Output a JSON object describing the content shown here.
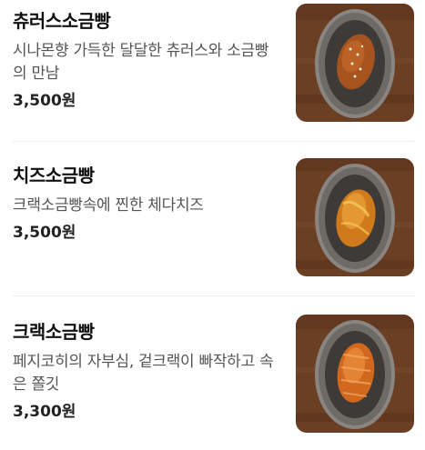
{
  "menu": {
    "items": [
      {
        "name": "츄러스소금빵",
        "description": "시나몬향 가득한 달달한 츄러스와 소금빵의 만남",
        "price": "3,500원"
      },
      {
        "name": "치즈소금빵",
        "description": "크랙소금빵속에 찐한 체다치즈",
        "price": "3,500원"
      },
      {
        "name": "크랙소금빵",
        "description": "페지코히의 자부심, 겉크랙이 빠작하고 속은 쫄깃",
        "price": "3,300원"
      }
    ]
  },
  "colors": {
    "table_wood": "#6b3f24",
    "plate_rim": "#6e6a66",
    "plate_inner": "#3d3a38",
    "bread_churros": "#a5531f",
    "bread_cheese": "#d07a1c",
    "bread_crack": "#d2681d"
  }
}
